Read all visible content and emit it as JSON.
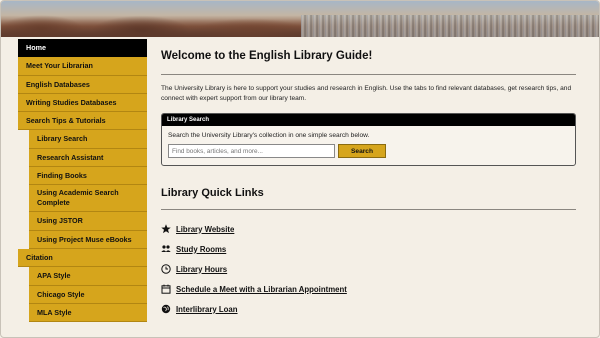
{
  "sidebar": {
    "items": [
      {
        "label": "Home",
        "active": true
      },
      {
        "label": "Meet Your Librarian"
      },
      {
        "label": "English Databases"
      },
      {
        "label": "Writing Studies Databases"
      },
      {
        "label": "Search Tips & Tutorials"
      },
      {
        "label": "Library Search"
      },
      {
        "label": "Research Assistant"
      },
      {
        "label": "Finding Books"
      },
      {
        "label": "Using Academic Search Complete"
      },
      {
        "label": "Using JSTOR"
      },
      {
        "label": "Using Project Muse eBooks"
      },
      {
        "label": "Citation"
      },
      {
        "label": "APA Style"
      },
      {
        "label": "Chicago Style"
      },
      {
        "label": "MLA Style"
      }
    ]
  },
  "main": {
    "title": "Welcome to the English Library Guide!",
    "intro": "The University Library is here to support your studies and research in English. Use the tabs to find relevant databases, get research tips, and connect with expert support from our library team.",
    "search": {
      "header": "Library Search",
      "description": "Search the University Library's collection in one simple search below.",
      "placeholder": "Find books, articles, and more...",
      "button": "Search"
    },
    "quick_links_title": "Library Quick Links",
    "quick_links": [
      {
        "label": "Library Website",
        "icon": "star-icon"
      },
      {
        "label": "Study Rooms",
        "icon": "users-icon"
      },
      {
        "label": "Library Hours",
        "icon": "clock-icon"
      },
      {
        "label": "Schedule a Meet with a Librarian Appointment",
        "icon": "calendar-icon"
      },
      {
        "label": "Interlibrary Loan",
        "icon": "globe-icon"
      }
    ]
  },
  "colors": {
    "accent": "#d6a51c",
    "background": "#f4efe6",
    "active": "#000000"
  }
}
